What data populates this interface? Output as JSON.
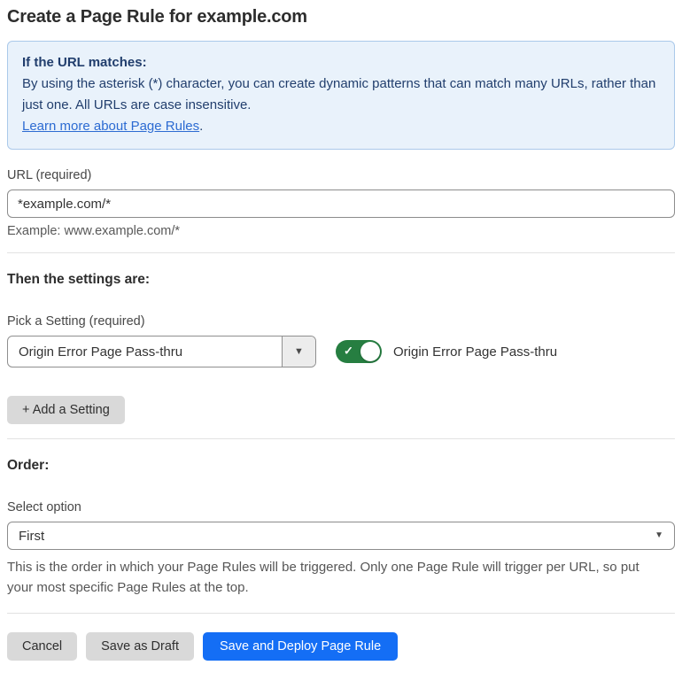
{
  "page": {
    "title": "Create a Page Rule for example.com"
  },
  "info_box": {
    "heading": "If the URL matches:",
    "body": "By using the asterisk (*) character, you can create dynamic patterns that can match many URLs, rather than just one. All URLs are case insensitive.",
    "link_label": "Learn more about Page Rules",
    "link_suffix": "."
  },
  "url_field": {
    "label": "URL (required)",
    "value": "*example.com/*",
    "helper": "Example: www.example.com/*"
  },
  "settings_section": {
    "heading": "Then the settings are:",
    "picker_label": "Pick a Setting (required)",
    "picker_value": "Origin Error Page Pass-thru",
    "caret_glyph": "▼",
    "toggle_state": "on",
    "toggle_check_glyph": "✓",
    "toggle_label": "Origin Error Page Pass-thru",
    "add_setting_label": "+ Add a Setting"
  },
  "order_section": {
    "heading": "Order:",
    "select_label": "Select option",
    "select_value": "First",
    "caret_glyph": "▼",
    "helper": "This is the order in which your Page Rules will be triggered. Only one Page Rule will trigger per URL, so put your most specific Page Rules at the top."
  },
  "footer": {
    "cancel_label": "Cancel",
    "save_draft_label": "Save as Draft",
    "save_deploy_label": "Save and Deploy Page Rule"
  },
  "colors": {
    "info_bg": "#e9f2fb",
    "info_border": "#abc9ea",
    "info_text": "#213e6d",
    "link_blue": "#2c6bd2",
    "toggle_on_green": "#267e41",
    "primary_button_blue": "#146ef5",
    "secondary_button_gray": "#d9d9d9"
  }
}
